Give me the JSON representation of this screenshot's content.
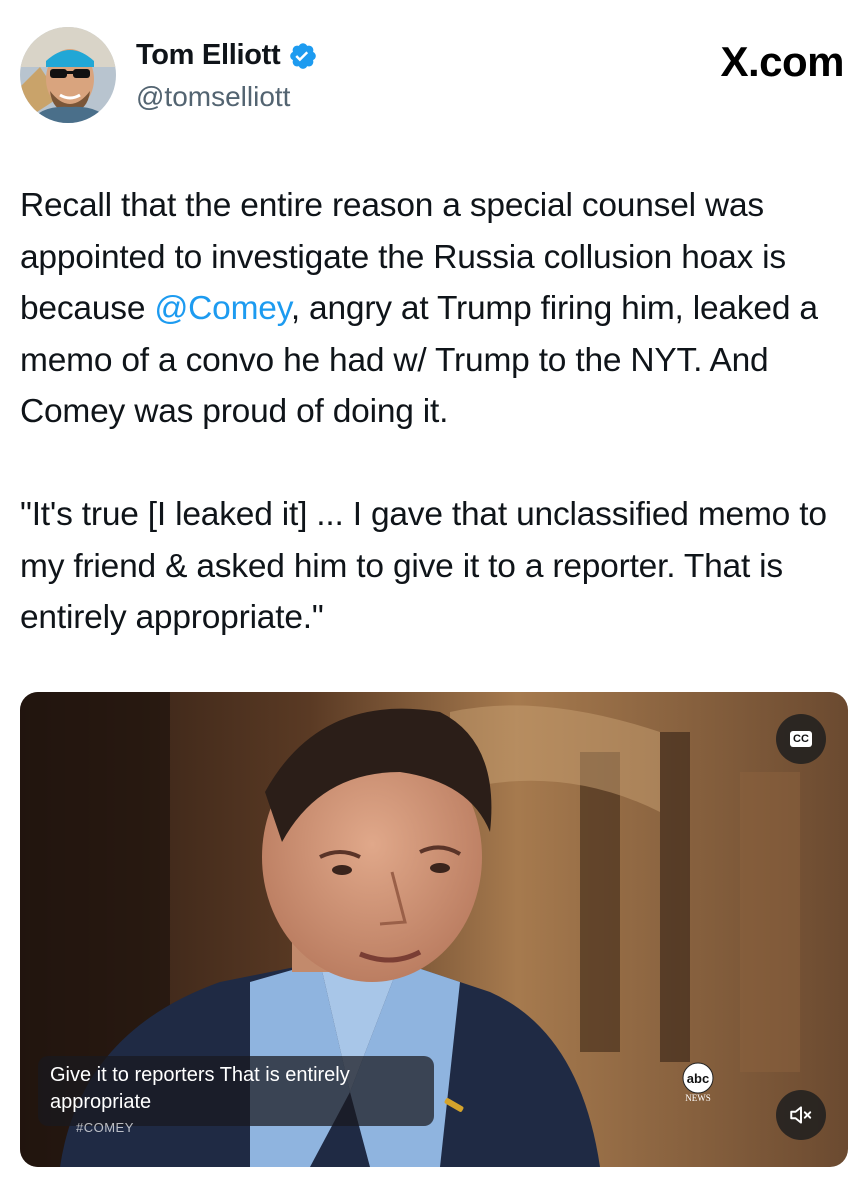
{
  "author": {
    "display_name": "Tom Elliott",
    "handle": "@tomselliott",
    "verified": true,
    "verified_icon": "verified-badge-icon"
  },
  "brand": {
    "label": "X.com"
  },
  "tweet": {
    "paragraph1": {
      "before_mention": "Recall that the entire reason a special counsel was appointed to investigate the Russia collusion hoax is because ",
      "mention": "@Comey",
      "after_mention": ", angry at Trump firing him, leaked a memo of a convo he had w/ Trump to the NYT. And Comey was proud of doing it."
    },
    "paragraph2": "\"It's true [I leaked it]  ... I gave that unclassified memo to my friend & asked him to give it to a reporter. That is entirely appropriate.\""
  },
  "video": {
    "caption_line1": "Give it to reporters That is entirely",
    "caption_line2": "appropriate",
    "hashtag": "#COMEY",
    "cc_label": "CC",
    "network_logo_text": "abc",
    "network_logo_sub": "NEWS",
    "cc_icon": "closed-captions-icon",
    "mute_icon": "speaker-muted-icon"
  },
  "colors": {
    "link": "#1d9bf0",
    "handle": "#536471",
    "text": "#0f1419",
    "verified": "#1d9bf0"
  }
}
